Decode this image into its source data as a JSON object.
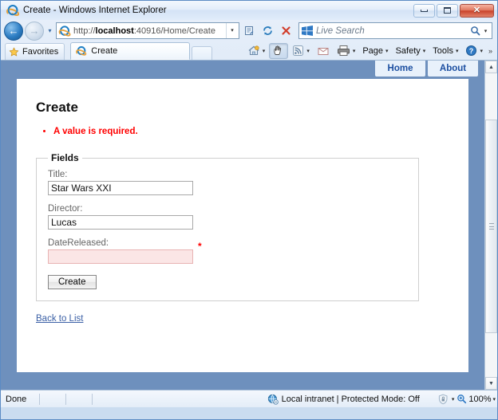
{
  "window": {
    "title": "Create - Windows Internet Explorer",
    "app_icon": "internet-explorer-icon",
    "minimize_label": "–",
    "maximize_label": "",
    "close_label": "✕"
  },
  "navigation": {
    "back_label": "←",
    "forward_label": "→",
    "recent_pages_caret": "▾",
    "url": "http://localhost:40916/Home/Create",
    "url_host": "localhost",
    "url_prefix": "http://",
    "url_suffix": ":40916/Home/Create",
    "url_dropdown_caret": "▾",
    "compat_view_icon": "compatibility-view-icon",
    "refresh_icon": "refresh-icon",
    "stop_icon": "stop-icon"
  },
  "search": {
    "placeholder": "Live Search",
    "provider_icon": "windows-live-icon",
    "search_icon": "magnifier-icon",
    "dropdown_caret": "▾"
  },
  "favorites": {
    "label": "Favorites",
    "icon": "star-icon"
  },
  "tabs": [
    {
      "label": "Create",
      "icon": "internet-explorer-icon",
      "active": true
    }
  ],
  "newtab": {
    "label": "",
    "name": "new-tab-button"
  },
  "commandbar": [
    {
      "name": "home-button",
      "label": "",
      "icon": "home-icon",
      "caret": "▾"
    },
    {
      "name": "caret-browsing-button",
      "label": "",
      "icon": "hand-icon",
      "caret": "",
      "pressed": true
    },
    {
      "name": "feeds-button",
      "label": "",
      "icon": "rss-icon",
      "caret": "▾"
    },
    {
      "name": "read-mail-button",
      "label": "",
      "icon": "mail-icon",
      "caret": ""
    },
    {
      "name": "print-button",
      "label": "",
      "icon": "printer-icon",
      "caret": "▾"
    },
    {
      "name": "page-menu",
      "label": "Page",
      "icon": "",
      "caret": "▾"
    },
    {
      "name": "safety-menu",
      "label": "Safety",
      "icon": "",
      "caret": "▾"
    },
    {
      "name": "tools-menu",
      "label": "Tools",
      "icon": "",
      "caret": "▾"
    },
    {
      "name": "help-menu",
      "label": "",
      "icon": "help-icon",
      "caret": "▾"
    }
  ],
  "commandbar_overflow": "»",
  "site": {
    "nav": [
      {
        "label": "Home",
        "name": "site-nav-home"
      },
      {
        "label": "About",
        "name": "site-nav-about"
      }
    ],
    "page_title": "Create",
    "validation_errors": [
      "A value is required."
    ],
    "fieldset_legend": "Fields",
    "fields": [
      {
        "name": "title",
        "label": "Title:",
        "value": "Star Wars XXI",
        "placeholder": "",
        "error": false,
        "required_marker": ""
      },
      {
        "name": "director",
        "label": "Director:",
        "value": "Lucas",
        "placeholder": "",
        "error": false,
        "required_marker": ""
      },
      {
        "name": "datereleased",
        "label": "DateReleased:",
        "value": "",
        "placeholder": "",
        "error": true,
        "required_marker": "*"
      }
    ],
    "submit_label": "Create",
    "back_link_label": "Back to List"
  },
  "scrollbar": {
    "up_arrow": "▲",
    "down_arrow": "▼"
  },
  "statusbar": {
    "status": "Done",
    "zone": "Local intranet | Protected Mode: Off",
    "zone_icon": "internet-zone-icon",
    "protected_mode_icon": "shield-icon",
    "protected_caret": "▾",
    "zoom_icon": "zoom-icon",
    "zoom_level": "100%",
    "zoom_caret": "▾"
  },
  "colors": {
    "page_background": "#6e90bd",
    "content_background": "#ffffff",
    "error_text": "#ff0000",
    "link": "#3a5fa5",
    "nav_link": "#1c4fa1",
    "error_field_background": "#fbe6e6"
  }
}
